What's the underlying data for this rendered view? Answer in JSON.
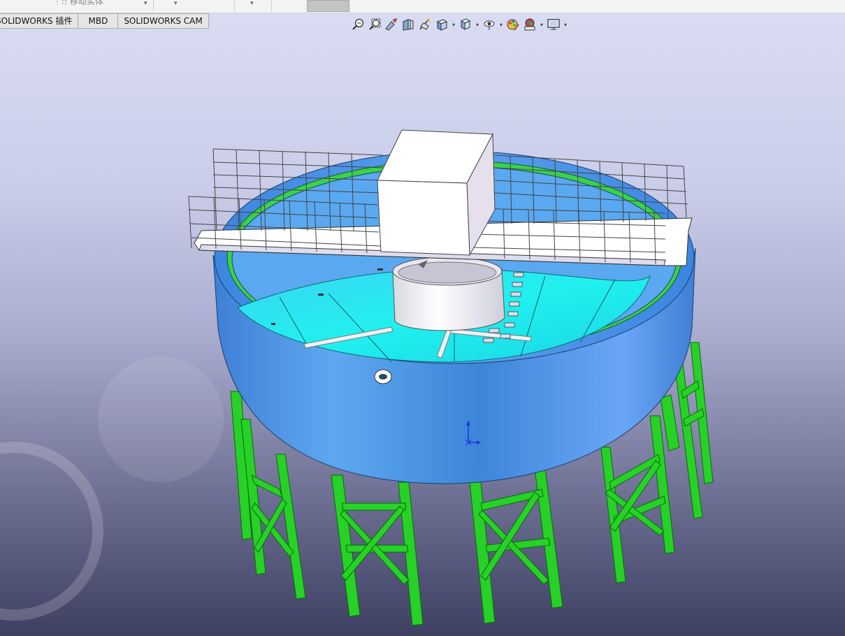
{
  "ribbon": {
    "move_body_label": "移动实体"
  },
  "tabs": [
    {
      "label": "SOLIDWORKS 插件",
      "active": false
    },
    {
      "label": "MBD",
      "active": false
    },
    {
      "label": "SOLIDWORKS CAM",
      "active": false
    }
  ],
  "heads_up_toolbar": [
    {
      "icon": "zoom-to-fit-icon"
    },
    {
      "icon": "zoom-to-area-icon"
    },
    {
      "icon": "previous-view-icon"
    },
    {
      "icon": "section-view-icon"
    },
    {
      "icon": "dynamic-annotation-views-icon"
    },
    {
      "icon": "view-orientation-icon",
      "dropdown": true
    },
    {
      "icon": "display-style-icon",
      "dropdown": true
    },
    {
      "icon": "hide-show-items-icon",
      "dropdown": true
    },
    {
      "icon": "edit-appearance-icon"
    },
    {
      "icon": "apply-scene-icon",
      "dropdown": true
    },
    {
      "icon": "view-settings-icon",
      "dropdown": true
    }
  ],
  "colors": {
    "tank_wall": "#4f8fe0",
    "tank_highlight": "#7fb6ff",
    "tank_floor": "#27e6f0",
    "frame_green": "#27d127",
    "rim_green": "#39d24a",
    "platform": "#ffffff",
    "axis_blue": "#1f35e0"
  }
}
